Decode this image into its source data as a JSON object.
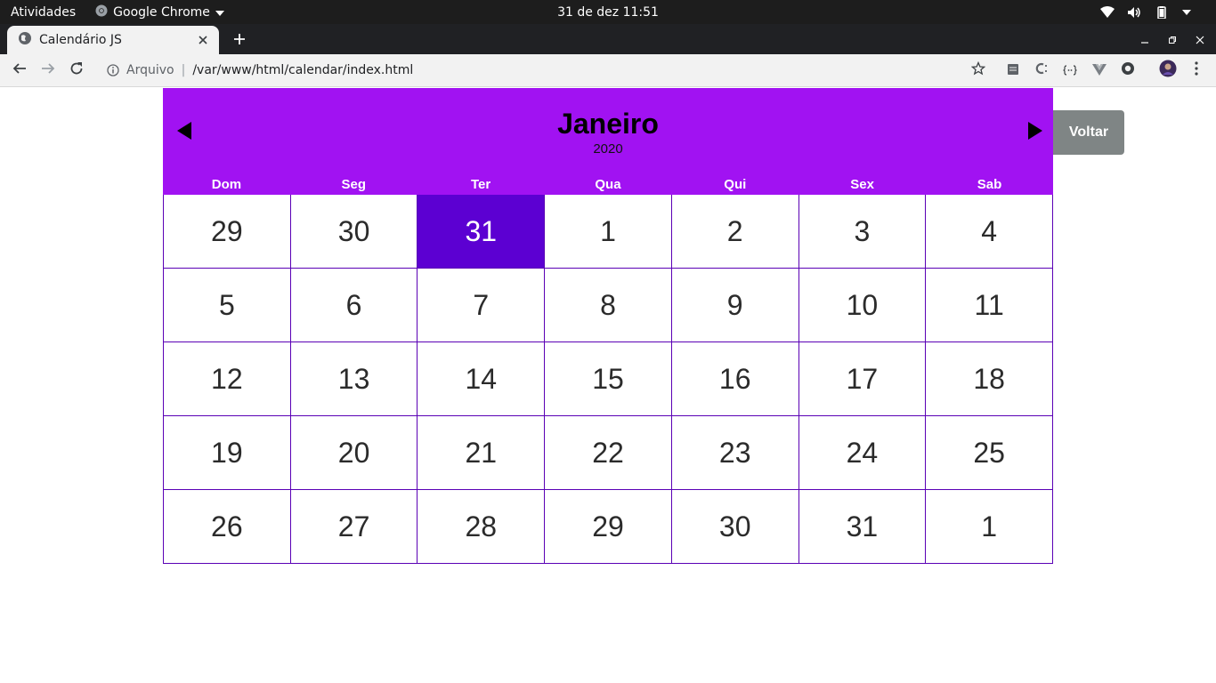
{
  "system_bar": {
    "activities": "Atividades",
    "app_name": "Google Chrome",
    "clock": "31 de dez  11:51",
    "icons": [
      "wifi-icon",
      "volume-icon",
      "battery-icon",
      "power-menu-icon"
    ]
  },
  "browser": {
    "tab_title": "Calendário JS",
    "security_label": "Arquivo",
    "url": "/var/www/html/calendar/index.html",
    "extension_icons": [
      "extension-list-icon",
      "extension-c-icon",
      "extension-braces-icon",
      "extension-vue-icon",
      "extension-circle-icon"
    ]
  },
  "calendar": {
    "month": "Janeiro",
    "year": "2020",
    "weekdays": [
      "Dom",
      "Seg",
      "Ter",
      "Qua",
      "Qui",
      "Sex",
      "Sab"
    ],
    "days": [
      [
        "29",
        "30",
        "31",
        "1",
        "2",
        "3",
        "4"
      ],
      [
        "5",
        "6",
        "7",
        "8",
        "9",
        "10",
        "11"
      ],
      [
        "12",
        "13",
        "14",
        "15",
        "16",
        "17",
        "18"
      ],
      [
        "19",
        "20",
        "21",
        "22",
        "23",
        "24",
        "25"
      ],
      [
        "26",
        "27",
        "28",
        "29",
        "30",
        "31",
        "1"
      ]
    ],
    "highlighted_day": "31",
    "back_button": "Voltar"
  },
  "colors": {
    "header_purple": "#a112f2",
    "today_purple": "#5c00d2",
    "grid_line": "#5a00b5",
    "button_gray": "#7f8585"
  }
}
